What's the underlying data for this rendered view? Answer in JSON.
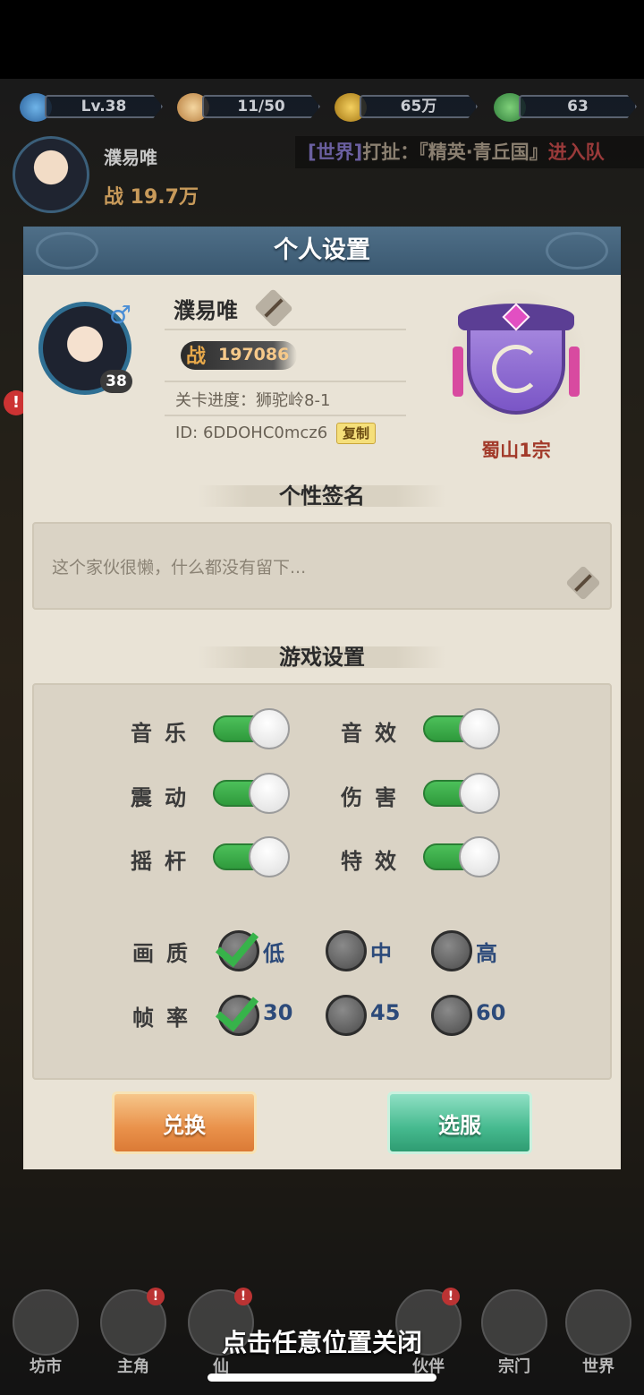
{
  "top_bar": {
    "level": "Lv.38",
    "stamina": "11/50",
    "coins": "65万",
    "jade": "63"
  },
  "header_player": {
    "name": "濮易唯",
    "power": "战 19.7万"
  },
  "world_chat": {
    "tag": "[世界]",
    "text": "打扯：『精英·青丘国』",
    "suffix": "进入队"
  },
  "modal": {
    "title": "个人设置",
    "profile": {
      "name": "濮易唯",
      "gender_icon": "male-icon",
      "level": "38",
      "power_prefix": "战",
      "power_value": "197086",
      "progress": "关卡进度：狮驼岭8-1",
      "id": "ID: 6DDOHC0mcz6",
      "copy_label": "复制"
    },
    "guild": {
      "name": "蜀山1宗"
    },
    "signature": {
      "section_title": "个性签名",
      "text": "这个家伙很懒，什么都没有留下..."
    },
    "game_settings": {
      "section_title": "游戏设置",
      "toggles": [
        {
          "label": "音乐",
          "on": true
        },
        {
          "label": "音效",
          "on": true
        },
        {
          "label": "震动",
          "on": true
        },
        {
          "label": "伤害",
          "on": true
        },
        {
          "label": "摇杆",
          "on": true
        },
        {
          "label": "特效",
          "on": true
        }
      ],
      "quality_label": "画质",
      "quality_options": [
        "低",
        "中",
        "高"
      ],
      "quality_selected": "低",
      "fps_label": "帧率",
      "fps_options": [
        "30",
        "45",
        "60"
      ],
      "fps_selected": "30"
    },
    "buttons": {
      "exchange": "兑换",
      "server": "选服"
    }
  },
  "bottom_nav": {
    "items": [
      "坊市",
      "主角",
      "仙",
      "伙伴",
      "宗门",
      "世界"
    ]
  },
  "close_hint": "点击任意位置关闭",
  "colors": {
    "toggle_on": "#3fb04d",
    "modal_bg": "#e9e3d6",
    "header_bg": "#45637b",
    "guild_name": "#a23a2a"
  }
}
